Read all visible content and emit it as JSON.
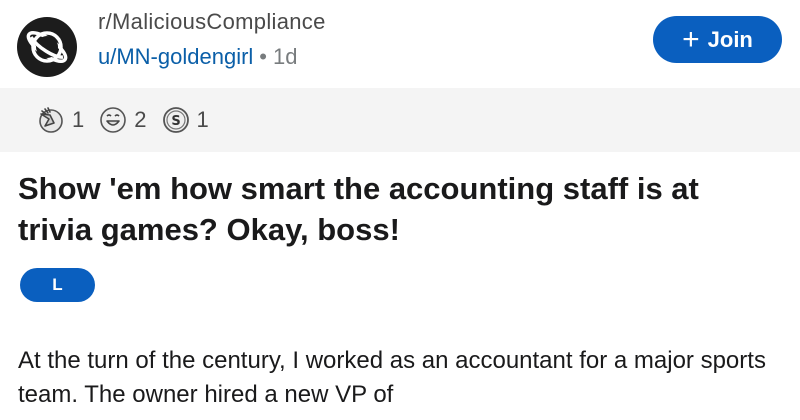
{
  "post": {
    "subreddit": "r/MaliciousCompliance",
    "author": "u/MN-goldengirl",
    "separator": "•",
    "age": "1d",
    "join_label": "Join",
    "join_icon": "plus-icon",
    "awards": [
      {
        "icon": "facepalm-award-icon",
        "count": "1"
      },
      {
        "icon": "haha-award-icon",
        "count": "2"
      },
      {
        "icon": "silver-award-icon",
        "count": "1"
      }
    ],
    "title": "Show 'em how smart the accounting staff is at trivia games? Okay, boss!",
    "flair": "L",
    "body": "At the turn of the century, I worked as an accountant for a major sports team. The owner hired a new VP of"
  },
  "colors": {
    "accent": "#0a5fbf",
    "username": "#0b5fa8",
    "award_bar": "#f4f4f4",
    "text": "#1a1a1b"
  }
}
